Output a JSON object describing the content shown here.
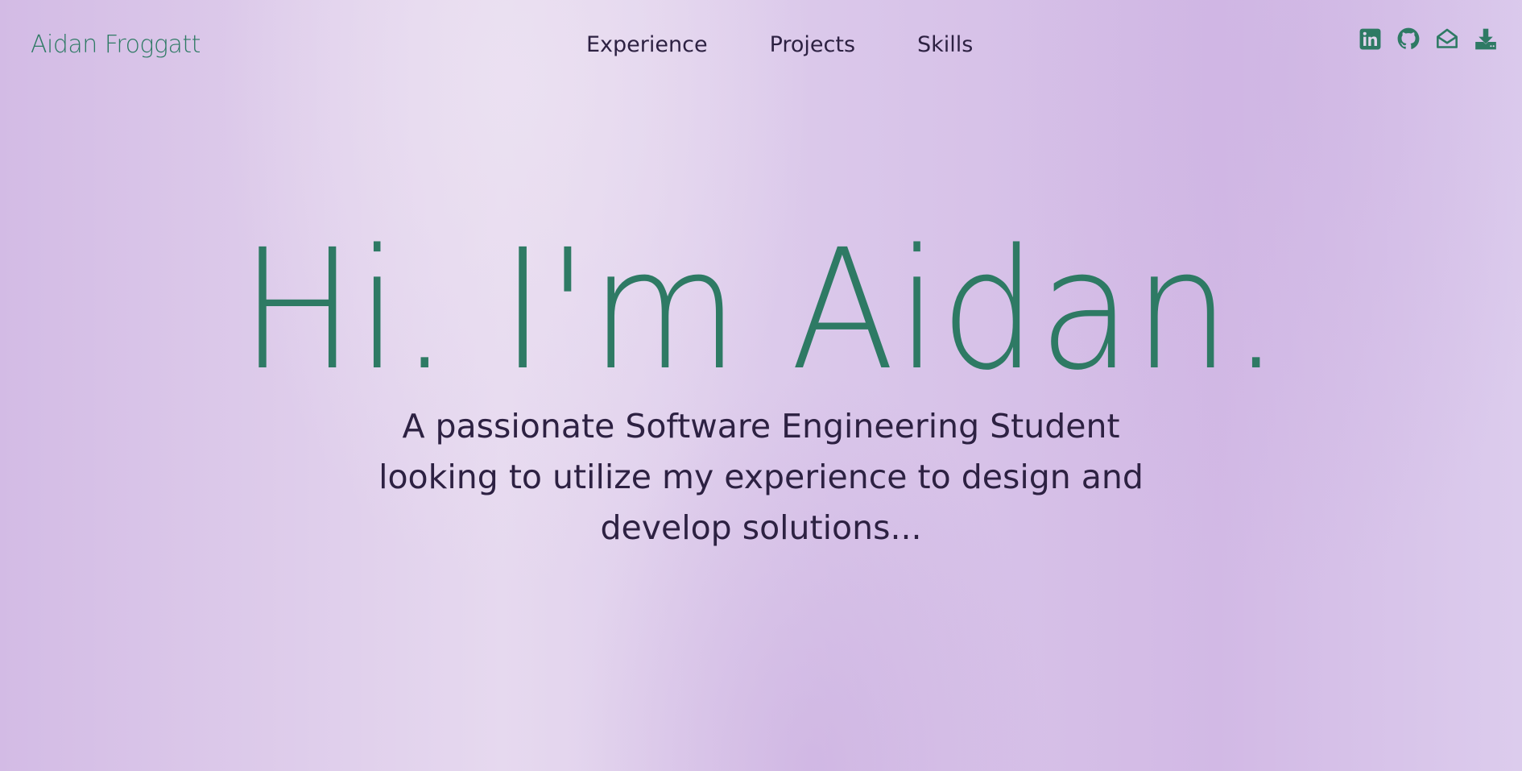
{
  "header": {
    "brand": "Aidan Froggatt",
    "nav": [
      {
        "label": "Experience"
      },
      {
        "label": "Projects"
      },
      {
        "label": "Skills"
      }
    ],
    "social_icons": [
      {
        "name": "linkedin-icon"
      },
      {
        "name": "github-icon"
      },
      {
        "name": "email-icon"
      },
      {
        "name": "download-resume-icon"
      }
    ]
  },
  "hero": {
    "title": "Hi. I'm Aidan.",
    "subtitle": "A passionate Software  Engineering Student\nlooking to utilize my experience to design and\ndevelop solutions..."
  },
  "colors": {
    "accent": "#2e7a64",
    "text": "#2d2142",
    "background_light": "#e6d9ef",
    "background_dark": "#d2b9e5"
  }
}
